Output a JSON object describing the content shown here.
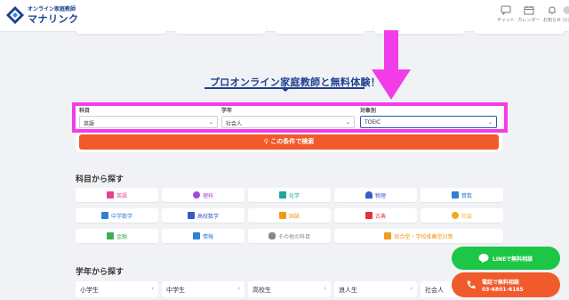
{
  "header": {
    "logo_sub": "オンライン家庭教師",
    "logo_main": "マナリンク",
    "icons": [
      {
        "name": "chat-icon",
        "label": "チャット"
      },
      {
        "name": "calendar-icon",
        "label": "カレンダー"
      },
      {
        "name": "bell-icon",
        "label": "お知らせ"
      },
      {
        "name": "avatar-icon",
        "label": "ログ"
      }
    ]
  },
  "promo": {
    "title": "プロオンライン家庭教師と無料体験！"
  },
  "search": {
    "subject_label": "科目",
    "subject_value": "英語",
    "grade_label": "学年",
    "grade_value": "社会人",
    "target_label": "対象別",
    "target_value": "TOEIC",
    "button_label": "この条件で検索"
  },
  "subjects_section": {
    "title": "科目から探す",
    "items": [
      {
        "label": "英語",
        "icon": "translate-icon",
        "color": "#e2468c"
      },
      {
        "label": "理科",
        "icon": "bulb-icon",
        "color": "#a24ad6"
      },
      {
        "label": "化学",
        "icon": "flask-icon",
        "color": "#1ea69a"
      },
      {
        "label": "物理",
        "icon": "magnet-icon",
        "color": "#3a59c9"
      },
      {
        "label": "算数",
        "icon": "calculator-icon",
        "color": "#2f7fd6"
      },
      {
        "label": "中学数学",
        "icon": "calculator-icon",
        "color": "#2f7fd6"
      },
      {
        "label": "高校数学",
        "icon": "calculator-icon",
        "color": "#3a59c9"
      },
      {
        "label": "国語",
        "icon": "book-icon",
        "color": "#f09a1c"
      },
      {
        "label": "古典",
        "icon": "scroll-icon",
        "color": "#e2333a"
      },
      {
        "label": "社会",
        "icon": "globe-icon",
        "color": "#f0a91c"
      },
      {
        "label": "金融",
        "icon": "chart-icon",
        "color": "#3fae52"
      },
      {
        "label": "情報",
        "icon": "laptop-icon",
        "color": "#2f7fd6"
      },
      {
        "label": "その他の科目",
        "icon": "chat-bubbles-icon",
        "color": "#888888"
      },
      {
        "label": "総合型・学校推薦型対策",
        "icon": "document-icon",
        "color": "#f09a1c"
      }
    ]
  },
  "grades_section": {
    "title": "学年から探す",
    "items": [
      {
        "label": "小学生"
      },
      {
        "label": "中学生"
      },
      {
        "label": "高校生"
      },
      {
        "label": "浪人生"
      },
      {
        "label": "社会人"
      }
    ]
  },
  "cta": {
    "line_label": "LINEで無料相談",
    "tel_label": "電話で無料相談",
    "tel_number": "03-6801-6165"
  },
  "colors": {
    "brand": "#1d3f8f",
    "accent": "#f15a2b",
    "highlight": "#f23ce8",
    "line_green": "#1ec646"
  }
}
